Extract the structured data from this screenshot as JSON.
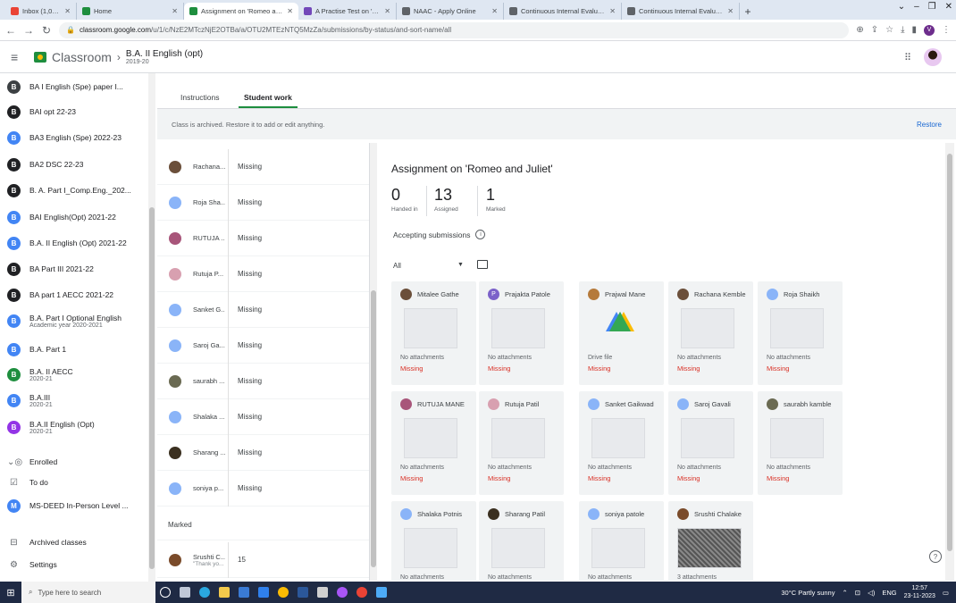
{
  "browser": {
    "tabs": [
      {
        "title": "Inbox (1,047) - vckiqac@gmail.c",
        "color": "#ea4335",
        "active": false
      },
      {
        "title": "Home",
        "color": "#1e8e3e",
        "active": false
      },
      {
        "title": "Assignment on 'Romeo and Juli",
        "color": "#1e8e3e",
        "active": true
      },
      {
        "title": "A Practise Test on 'Romeo and",
        "color": "#7248b9",
        "active": false
      },
      {
        "title": "NAAC - Apply Online",
        "color": "#5f6368",
        "active": false
      },
      {
        "title": "Continuous Internal Evaluation",
        "color": "#5f6368",
        "active": false
      },
      {
        "title": "Continuous Internal Evaluation",
        "color": "#5f6368",
        "active": false
      }
    ],
    "url_host": "classroom.google.com",
    "url_path": "/u/1/c/NzE2MTczNjE2OTBa/a/OTU2MTEzNTQ5MzZa/submissions/by-status/and-sort-name/all",
    "profile_letter": "V"
  },
  "header": {
    "app_name": "Classroom",
    "class_name": "B.A. II English (opt)",
    "class_year": "2019-20"
  },
  "sidebar": {
    "items": [
      {
        "badge": "B",
        "color": "#3c4043",
        "name": "BA I English (Spe) paper I...",
        "sub": ""
      },
      {
        "badge": "B",
        "color": "#202124",
        "name": "BAI opt 22-23",
        "sub": ""
      },
      {
        "badge": "B",
        "color": "#4285f4",
        "name": "BA3 English (Spe) 2022-23",
        "sub": ""
      },
      {
        "badge": "B",
        "color": "#202124",
        "name": "BA2 DSC 22-23",
        "sub": ""
      },
      {
        "badge": "B",
        "color": "#202124",
        "name": "B. A. Part I_Comp.Eng._202...",
        "sub": ""
      },
      {
        "badge": "B",
        "color": "#4285f4",
        "name": "BAI English(Opt) 2021-22",
        "sub": ""
      },
      {
        "badge": "B",
        "color": "#4285f4",
        "name": "B.A. II English (Opt) 2021-22",
        "sub": ""
      },
      {
        "badge": "B",
        "color": "#202124",
        "name": "BA Part III 2021-22",
        "sub": ""
      },
      {
        "badge": "B",
        "color": "#202124",
        "name": "BA part 1 AECC 2021-22",
        "sub": ""
      },
      {
        "badge": "B",
        "color": "#4285f4",
        "name": "B.A. Part I Optional English",
        "sub": "Academic year 2020-2021"
      },
      {
        "badge": "B",
        "color": "#4285f4",
        "name": "B.A. Part 1",
        "sub": ""
      },
      {
        "badge": "B",
        "color": "#1e8e3e",
        "name": "B.A. II AECC",
        "sub": "2020-21"
      },
      {
        "badge": "B",
        "color": "#4285f4",
        "name": "B.A.III",
        "sub": "2020-21"
      },
      {
        "badge": "B",
        "color": "#9334e6",
        "name": "B.A.II English (Opt)",
        "sub": "2020-21"
      }
    ],
    "enrolled_label": "Enrolled",
    "todo_label": "To do",
    "enrolled_class": {
      "badge": "M",
      "color": "#4285f4",
      "name": "MS-DEED In-Person Level ..."
    },
    "archived_label": "Archived classes",
    "settings_label": "Settings"
  },
  "main_tabs": {
    "instructions": "Instructions",
    "student_work": "Student work"
  },
  "archive_banner": {
    "message": "Class is archived. Restore it to add or edit anything.",
    "restore": "Restore"
  },
  "roster": {
    "rows": [
      {
        "name": "Rachana...",
        "status": "Missing",
        "color": "#6b4f3a"
      },
      {
        "name": "Roja Sha...",
        "status": "Missing",
        "color": "#8ab4f8"
      },
      {
        "name": "RUTUJA ...",
        "status": "Missing",
        "color": "#a8557a"
      },
      {
        "name": "Rutuja P...",
        "status": "Missing",
        "color": "#d8a0b0"
      },
      {
        "name": "Sanket G...",
        "status": "Missing",
        "color": "#8ab4f8"
      },
      {
        "name": "Saroj Ga...",
        "status": "Missing",
        "color": "#8ab4f8"
      },
      {
        "name": "saurabh ...",
        "status": "Missing",
        "color": "#6a6a52"
      },
      {
        "name": "Shalaka ...",
        "status": "Missing",
        "color": "#8ab4f8"
      },
      {
        "name": "Sharang ...",
        "status": "Missing",
        "color": "#3b3020"
      },
      {
        "name": "soniya p...",
        "status": "Missing",
        "color": "#8ab4f8"
      }
    ],
    "marked_label": "Marked",
    "marked_row": {
      "name": "Srushti C...",
      "sub": "\"Thank yo...",
      "status": "15",
      "color": "#7a4b2a"
    }
  },
  "detail": {
    "title": "Assignment on 'Romeo and Juliet'",
    "stats": [
      {
        "num": "0",
        "label": "Handed in"
      },
      {
        "num": "13",
        "label": "Assigned"
      },
      {
        "num": "1",
        "label": "Marked"
      }
    ],
    "accepting": "Accepting submissions",
    "filter": "All",
    "cards": [
      {
        "name": "Mitalee Gathe",
        "avatar": "",
        "color": "#6b4f3a",
        "attach": "No attachments",
        "status": "Missing"
      },
      {
        "name": "Prajakta Patole",
        "avatar": "P",
        "color": "#7b61c9",
        "attach": "No attachments",
        "status": "Missing"
      },
      {
        "name": "Prajwal Mane",
        "avatar": "",
        "color": "#b57a3b",
        "attach": "Drive file",
        "status": "Missing",
        "drive": true
      },
      {
        "name": "Rachana Kemble",
        "avatar": "",
        "color": "#6b4f3a",
        "attach": "No attachments",
        "status": "Missing"
      },
      {
        "name": "Roja Shaikh",
        "avatar": "",
        "color": "#8ab4f8",
        "attach": "No attachments",
        "status": "Missing"
      },
      {
        "name": "RUTUJA MANE",
        "avatar": "",
        "color": "#a8557a",
        "attach": "No attachments",
        "status": "Missing"
      },
      {
        "name": "Rutuja Patil",
        "avatar": "",
        "color": "#d8a0b0",
        "attach": "No attachments",
        "status": "Missing"
      },
      {
        "name": "Sanket Gaikwad",
        "avatar": "",
        "color": "#8ab4f8",
        "attach": "No attachments",
        "status": "Missing"
      },
      {
        "name": "Saroj Gavali",
        "avatar": "",
        "color": "#8ab4f8",
        "attach": "No attachments",
        "status": "Missing"
      },
      {
        "name": "saurabh kamble",
        "avatar": "",
        "color": "#6a6a52",
        "attach": "No attachments",
        "status": "Missing"
      },
      {
        "name": "Shalaka Potnis",
        "avatar": "",
        "color": "#8ab4f8",
        "attach": "No attachments",
        "status": ""
      },
      {
        "name": "Sharang Patil",
        "avatar": "",
        "color": "#3b3020",
        "attach": "No attachments",
        "status": ""
      },
      {
        "name": "soniya patole",
        "avatar": "",
        "color": "#8ab4f8",
        "attach": "No attachments",
        "status": ""
      },
      {
        "name": "Srushti Chalake",
        "avatar": "",
        "color": "#7a4b2a",
        "attach": "3 attachments",
        "status": "",
        "photo": true
      }
    ]
  },
  "taskbar": {
    "search_placeholder": "Type here to search",
    "weather": "30°C  Partly sunny",
    "lang": "ENG",
    "time": "12:57",
    "date": "23-11-2023"
  }
}
